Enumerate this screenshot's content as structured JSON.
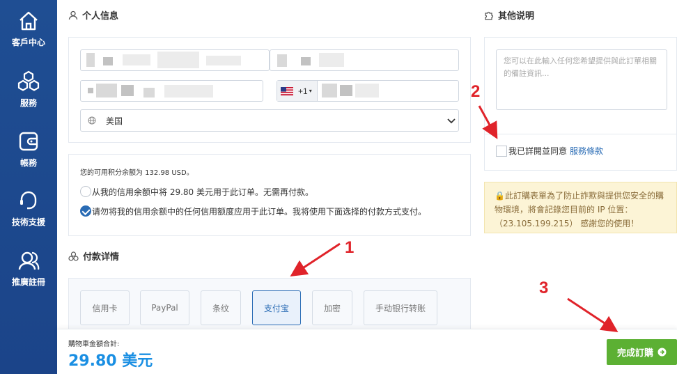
{
  "sidebar": {
    "items": [
      {
        "label": "客戶中心",
        "icon": "home-icon"
      },
      {
        "label": "服務",
        "icon": "cubes-icon"
      },
      {
        "label": "帳務",
        "icon": "wallet-icon"
      },
      {
        "label": "技術支援",
        "icon": "headset-icon"
      },
      {
        "label": "推廣註冊",
        "icon": "users-icon"
      }
    ]
  },
  "personal": {
    "title": "个人信息",
    "phone_code": "+1",
    "country_value": "美国"
  },
  "credit": {
    "balance_text": "您的可用积分余额为 132.98 USD。",
    "option_apply": "从我的信用余额中将 29.80 美元用于此订单。无需再付款。",
    "option_skip": "请勿将我的信用余额中的任何信用额度应用于此订单。我将使用下面选择的付款方式支付。"
  },
  "payment": {
    "title": "付款详情",
    "methods": [
      "信用卡",
      "PayPal",
      "条纹",
      "支付宝",
      "加密",
      "手动银行转账"
    ],
    "selected": "支付宝"
  },
  "notes": {
    "title": "其他说明",
    "placeholder": "您可以在此輸入任何您希望提供與此訂單相關的備註資訊...",
    "tos_text": "我已詳閱並同意",
    "tos_link": "服務條款"
  },
  "security_notice": "🔒此訂購表單為了防止詐欺與提供您安全的購物環境，將會記錄您目前的 IP 位置：（23.105.199.215） 感謝您的使用！",
  "footer": {
    "total_label": "購物車金額合計:",
    "total_value": "29.80 美元",
    "complete_button": "完成訂購"
  },
  "annotations": [
    "1",
    "2",
    "3"
  ],
  "colors": {
    "sidebar": "#1f4e93",
    "accent": "#2a6cb5",
    "total": "#1a8fe3",
    "complete": "#5cb033",
    "annotation": "#e0232a"
  }
}
